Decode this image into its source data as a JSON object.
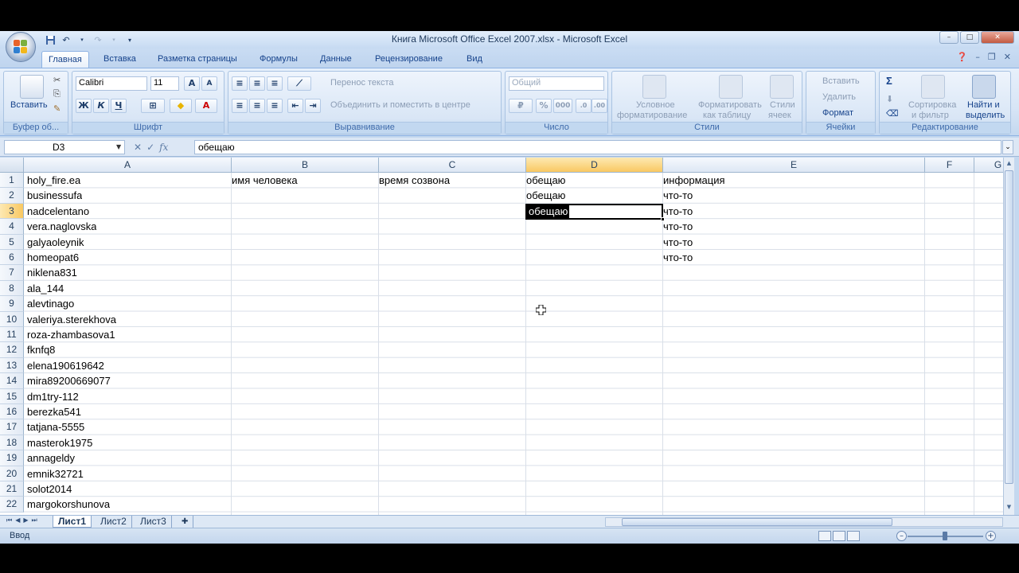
{
  "window": {
    "title": "Книга Microsoft Office Excel 2007.xlsx - Microsoft Excel",
    "controls": {
      "minimize": "–",
      "maximize": "□",
      "close": "✕"
    }
  },
  "ribbon_tabs": [
    "Главная",
    "Вставка",
    "Разметка страницы",
    "Формулы",
    "Данные",
    "Рецензирование",
    "Вид"
  ],
  "ribbon": {
    "clipboard": {
      "paste": "Вставить",
      "label": "Буфер об..."
    },
    "font": {
      "name": "Calibri",
      "size": "11",
      "bold": "Ж",
      "italic": "К",
      "underline": "Ч",
      "label": "Шрифт"
    },
    "alignment": {
      "wrap": "Перенос текста",
      "merge": "Объединить и поместить в центре",
      "label": "Выравнивание"
    },
    "number": {
      "format": "Общий",
      "percent": "%",
      "thousands": "000",
      "label": "Число"
    },
    "styles": {
      "conditional": "Условное",
      "conditional2": "форматирование",
      "table": "Форматировать",
      "table2": "как таблицу",
      "cell": "Стили",
      "cell2": "ячеек",
      "label": "Стили"
    },
    "cells": {
      "insert": "Вставить",
      "delete": "Удалить",
      "format": "Формат",
      "label": "Ячейки"
    },
    "editing": {
      "sum": "Σ",
      "sort": "Сортировка",
      "sort2": "и фильтр",
      "find": "Найти и",
      "find2": "выделить",
      "label": "Редактирование"
    }
  },
  "formula_bar": {
    "name_box": "D3",
    "fx": "fx",
    "value": "обещаю"
  },
  "columns": [
    "A",
    "B",
    "C",
    "D",
    "E",
    "F",
    "G"
  ],
  "selected_column": "D",
  "selected_row": 3,
  "rows": [
    {
      "n": "1",
      "A": "holy_fire.ea",
      "B": "имя человека",
      "C": "время созвона",
      "D": "обещаю",
      "E": "информация"
    },
    {
      "n": "2",
      "A": "businessufa",
      "B": "",
      "C": "",
      "D": "обещаю",
      "E": "что-то"
    },
    {
      "n": "3",
      "A": "nadcelentano",
      "B": "",
      "C": "",
      "D": "обещаю",
      "E": "что-то"
    },
    {
      "n": "4",
      "A": "vera.naglovska",
      "B": "",
      "C": "",
      "D": "",
      "E": "что-то"
    },
    {
      "n": "5",
      "A": "galyaoleynik",
      "B": "",
      "C": "",
      "D": "",
      "E": "что-то"
    },
    {
      "n": "6",
      "A": "homeopat6",
      "B": "",
      "C": "",
      "D": "",
      "E": "что-то"
    },
    {
      "n": "7",
      "A": "niklena831",
      "B": "",
      "C": "",
      "D": "",
      "E": ""
    },
    {
      "n": "8",
      "A": "ala_144",
      "B": "",
      "C": "",
      "D": "",
      "E": ""
    },
    {
      "n": "9",
      "A": "alevtinago",
      "B": "",
      "C": "",
      "D": "",
      "E": ""
    },
    {
      "n": "10",
      "A": "valeriya.sterekhova",
      "B": "",
      "C": "",
      "D": "",
      "E": ""
    },
    {
      "n": "11",
      "A": "roza-zhambasova1",
      "B": "",
      "C": "",
      "D": "",
      "E": ""
    },
    {
      "n": "12",
      "A": "fknfq8",
      "B": "",
      "C": "",
      "D": "",
      "E": ""
    },
    {
      "n": "13",
      "A": "elena190619642",
      "B": "",
      "C": "",
      "D": "",
      "E": ""
    },
    {
      "n": "14",
      "A": "mira89200669077",
      "B": "",
      "C": "",
      "D": "",
      "E": ""
    },
    {
      "n": "15",
      "A": "dm1try-112",
      "B": "",
      "C": "",
      "D": "",
      "E": ""
    },
    {
      "n": "16",
      "A": "berezka541",
      "B": "",
      "C": "",
      "D": "",
      "E": ""
    },
    {
      "n": "17",
      "A": "tatjana-5555",
      "B": "",
      "C": "",
      "D": "",
      "E": ""
    },
    {
      "n": "18",
      "A": "masterok1975",
      "B": "",
      "C": "",
      "D": "",
      "E": ""
    },
    {
      "n": "19",
      "A": "annageldy",
      "B": "",
      "C": "",
      "D": "",
      "E": ""
    },
    {
      "n": "20",
      "A": "emnik32721",
      "B": "",
      "C": "",
      "D": "",
      "E": ""
    },
    {
      "n": "21",
      "A": "solot2014",
      "B": "",
      "C": "",
      "D": "",
      "E": ""
    },
    {
      "n": "22",
      "A": "margokorshunova",
      "B": "",
      "C": "",
      "D": "",
      "E": ""
    }
  ],
  "sheets": [
    "Лист1",
    "Лист2",
    "Лист3"
  ],
  "active_sheet": "Лист1",
  "status": {
    "mode": "Ввод"
  }
}
